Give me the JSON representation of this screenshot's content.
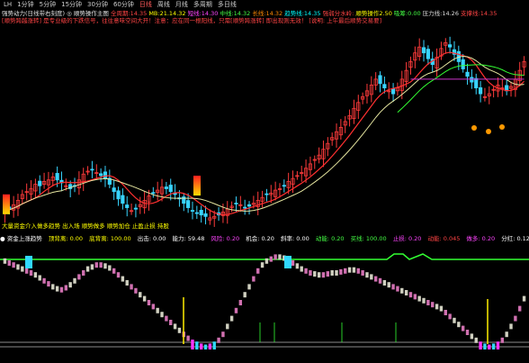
{
  "toolbar": {
    "items": [
      "LH",
      "1分钟",
      "5分钟",
      "15分钟",
      "30分钟",
      "60分钟",
      "日线",
      "周线",
      "月线",
      "多周期",
      "多日线"
    ],
    "active_index": 6
  },
  "legend": {
    "items": [
      {
        "text": "强势动力(日线带右刻度) ◎ 顺势操作主图",
        "color": "#e0e0e0"
      },
      {
        "text": "全周期:14.35",
        "color": "#ff4444"
      },
      {
        "text": "MB:21.14.32",
        "color": "#ffff00"
      },
      {
        "text": "短线:14.30",
        "color": "#ff44ff"
      },
      {
        "text": "中线:14.32",
        "color": "#44ff44"
      },
      {
        "text": "长线:14.32",
        "color": "#ff8800"
      },
      {
        "text": "趋势线:14.35",
        "color": "#00ffff"
      },
      {
        "text": "强弱分水岭:",
        "color": "#ff4444"
      },
      {
        "text": "顺势操作2.50",
        "color": "#ffff00"
      },
      {
        "text": "吸筹:0.00",
        "color": "#44ff44"
      },
      {
        "text": "压力线:14.26",
        "color": "#dddddd"
      },
      {
        "text": "支撑线:14.35",
        "color": "#ff4444"
      }
    ]
  },
  "note": {
    "text": "[顺势跨越涨转] 是专业级的下跌信号，往往意味空间大开！注意：应在同一根阳线，只需[顺势跨涨转] 即出现则无效！ [说明: 上午最后顺势交易要]",
    "color": "#ff4444"
  },
  "bottom_note": {
    "text": "大量资金介入做多趋势 出入场 顺势做多 顺势加仓 止盈止损 持股",
    "color": "#ffff00"
  },
  "indicator_legend": {
    "items": [
      {
        "text": "● 资金上涨趋势",
        "color": "#ffffff"
      },
      {
        "text": "顶背离: 0.00",
        "color": "#ffff00"
      },
      {
        "text": "底背离: 100.00",
        "color": "#ffff00"
      },
      {
        "text": "出击: 0.00",
        "color": "#ffffff"
      },
      {
        "text": "能力: 59.48",
        "color": "#ffffff"
      },
      {
        "text": "风险: 0.20",
        "color": "#ff44ff"
      },
      {
        "text": "机会: 0.20",
        "color": "#ffffff"
      },
      {
        "text": "斜率: 0.00",
        "color": "#ffffff"
      },
      {
        "text": "动能: 0.20",
        "color": "#44ff44"
      },
      {
        "text": "买线: 100.00",
        "color": "#44ff44"
      },
      {
        "text": "止损: 0.20",
        "color": "#ff44ff"
      },
      {
        "text": "动能: 0.045",
        "color": "#ff4444"
      },
      {
        "text": "做多: 0.20",
        "color": "#ff44ff"
      },
      {
        "text": "分红: 0.12",
        "color": "#ffffff"
      },
      {
        "text": "空闭: 0.14",
        "color": "#44ff44"
      }
    ]
  },
  "colors": {
    "up": "#ff3b3b",
    "down": "#38d4ff",
    "ma_fast": "#ff3030",
    "ma_slow": "#e6e6a0",
    "ma_long": "#33ff33",
    "purple_line": "#cc33cc",
    "ind_up": "#d0d0c0",
    "ind_pink": "#d070b0",
    "ind_cyan": "#30d8ff",
    "ind_magenta": "#ff33ff",
    "ind_green": "#33ff33",
    "ind_yellow": "#ffee00",
    "baseline": "#bbbbbb"
  },
  "chart_data": [
    {
      "type": "candlestick",
      "title": "",
      "bars_visible": 120,
      "note": "approximate price path",
      "close_path": [
        10.8,
        10.9,
        11.2,
        11.5,
        11.9,
        12.1,
        12.3,
        12.6,
        12.5,
        12.8,
        12.9,
        13.1,
        12.9,
        12.7,
        12.5,
        12.3,
        12.5,
        12.9,
        13.3,
        13.5,
        13.6,
        13.4,
        13.2,
        13.0,
        12.6,
        12.1,
        11.6,
        11.3,
        11.0,
        10.8,
        10.9,
        11.2,
        11.5,
        11.8,
        12.0,
        12.2,
        12.4,
        12.3,
        12.1,
        11.9,
        11.6,
        11.3,
        11.0,
        10.8,
        10.6,
        10.5,
        10.4,
        10.3,
        10.4,
        10.5,
        10.7,
        10.9,
        11.1,
        11.3,
        11.2,
        11.0,
        11.1,
        11.3,
        11.5,
        11.7,
        11.9,
        12.0,
        12.2,
        12.3,
        12.5,
        12.8,
        13.0,
        13.2,
        13.4,
        13.7,
        14.0,
        14.3,
        14.6,
        15.0,
        15.4,
        15.8,
        16.2,
        16.5,
        16.9,
        17.3,
        17.8,
        18.2,
        18.6,
        19.0,
        19.4,
        19.8,
        19.5,
        19.2,
        19.0,
        18.8,
        19.2,
        19.8,
        20.4,
        21.0,
        21.6,
        22.0,
        21.6,
        21.2,
        20.8,
        21.3,
        21.9,
        22.3,
        22.0,
        21.5,
        21.0,
        20.5,
        20.0,
        19.6,
        19.2,
        18.8,
        18.6,
        18.8,
        19.1,
        19.4,
        19.2,
        19.0,
        19.3,
        19.8,
        20.4,
        21.0
      ],
      "ylim": [
        9.8,
        23.0
      ]
    },
    {
      "type": "bar",
      "title": "",
      "note": "oscillator histogram, approx values 0-100",
      "values": [
        92,
        90,
        88,
        86,
        84,
        82,
        80,
        78,
        75,
        72,
        69,
        66,
        64,
        63,
        65,
        68,
        72,
        76,
        80,
        84,
        86,
        88,
        88,
        87,
        85,
        82,
        78,
        74,
        70,
        66,
        62,
        58,
        54,
        50,
        46,
        42,
        38,
        34,
        30,
        26,
        22,
        18,
        14,
        10,
        8,
        6,
        5,
        6,
        8,
        12,
        18,
        26,
        34,
        42,
        50,
        58,
        66,
        74,
        82,
        88,
        92,
        94,
        96,
        96,
        95,
        93,
        90,
        87,
        84,
        82,
        80,
        79,
        78,
        78,
        79,
        80,
        80,
        81,
        82,
        83,
        83,
        82,
        80,
        78,
        76,
        74,
        72,
        70,
        68,
        66,
        64,
        62,
        60,
        58,
        56,
        54,
        52,
        50,
        48,
        46,
        44,
        40,
        36,
        32,
        28,
        24,
        20,
        16,
        12,
        8,
        6,
        5,
        6,
        8,
        12,
        18,
        26,
        34,
        44,
        54
      ],
      "ylim": [
        0,
        100
      ]
    }
  ]
}
